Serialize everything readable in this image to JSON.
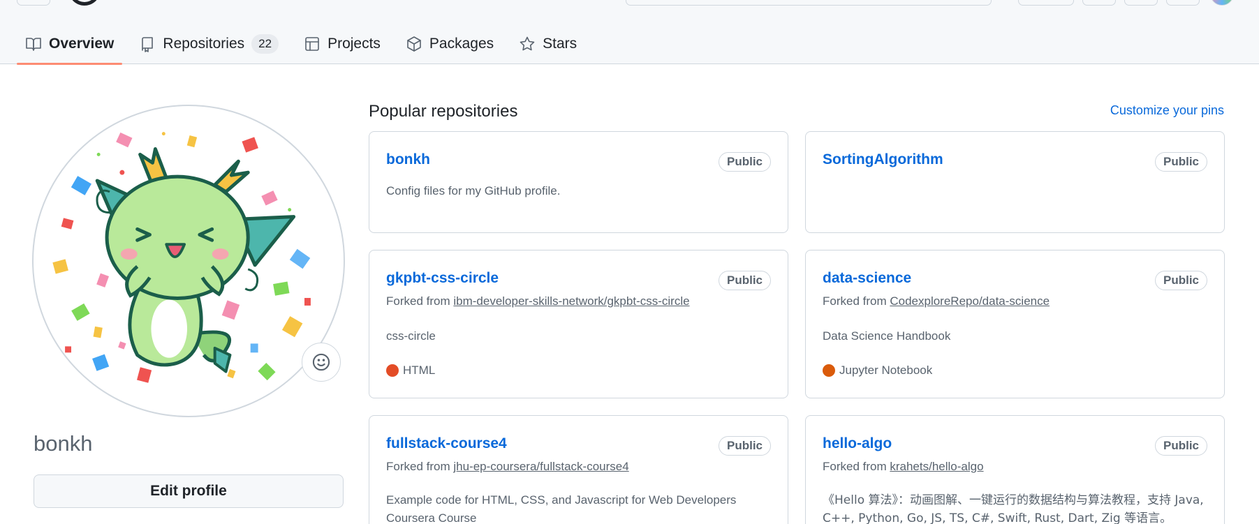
{
  "tabs": [
    {
      "label": "Overview",
      "icon": "book-icon",
      "active": true
    },
    {
      "label": "Repositories",
      "icon": "repo-icon",
      "count": "22"
    },
    {
      "label": "Projects",
      "icon": "table-icon"
    },
    {
      "label": "Packages",
      "icon": "package-icon"
    },
    {
      "label": "Stars",
      "icon": "star-icon"
    }
  ],
  "profile": {
    "username": "bonkh",
    "edit_label": "Edit profile",
    "avatar": "green-dragon-confetti-avatar",
    "status_icon": "smiley-icon"
  },
  "pinned": {
    "title": "Popular repositories",
    "customize_label": "Customize your pins",
    "repos": [
      {
        "name": "bonkh",
        "visibility": "Public",
        "description": "Config files for my GitHub profile."
      },
      {
        "name": "SortingAlgorithm",
        "visibility": "Public"
      },
      {
        "name": "gkpbt-css-circle",
        "visibility": "Public",
        "forked_prefix": "Forked from ",
        "forked_from": "ibm-developer-skills-network/gkpbt-css-circle",
        "description": "css-circle",
        "language": "HTML",
        "language_color": "#e34c26"
      },
      {
        "name": "data-science",
        "visibility": "Public",
        "forked_prefix": "Forked from ",
        "forked_from": "CodexploreRepo/data-science",
        "description": "Data Science Handbook",
        "language": "Jupyter Notebook",
        "language_color": "#da5b0b"
      },
      {
        "name": "fullstack-course4",
        "visibility": "Public",
        "forked_prefix": "Forked from ",
        "forked_from": "jhu-ep-coursera/fullstack-course4",
        "description": "Example code for HTML, CSS, and Javascript for Web Developers Coursera Course"
      },
      {
        "name": "hello-algo",
        "visibility": "Public",
        "forked_prefix": "Forked from ",
        "forked_from": "krahets/hello-algo",
        "description": "《Hello 算法》：动画图解、一键运行的数据结构与算法教程，支持 Java, C++, Python, Go, JS, TS, C#, Swift, Rust, Dart, Zig 等语言。"
      }
    ]
  }
}
